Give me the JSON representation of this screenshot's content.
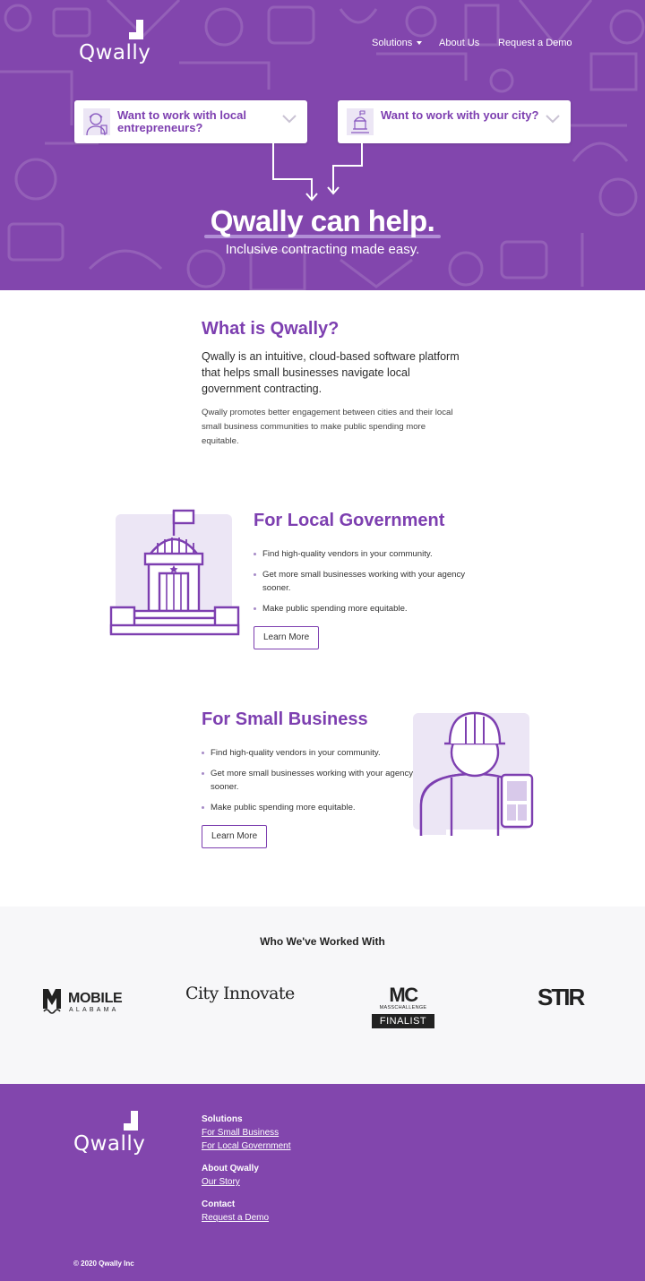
{
  "brand": {
    "name": "Qwally"
  },
  "nav": {
    "solutions": "Solutions",
    "about": "About Us",
    "demo": "Request a Demo"
  },
  "hero": {
    "card_left": "Want to work with local entrepreneurs?",
    "card_right": "Want to work with your city?",
    "title": "Qwally can help.",
    "subtitle": "Inclusive contracting made easy."
  },
  "what": {
    "title": "What is Qwally?",
    "lead": "Qwally is an intuitive, cloud-based software platform that helps small businesses navigate local government contracting.",
    "small": "Qwally promotes better engagement between cities and their local small business communities to make public spending more equitable."
  },
  "gov": {
    "title": "For Local Government",
    "bullets": [
      "Find high-quality vendors in your community.",
      "Get more small businesses working with your agency sooner.",
      "Make public spending more equitable."
    ],
    "button": "Learn More"
  },
  "biz": {
    "title": "For Small Business",
    "bullets": [
      "Find high-quality vendors in your community.",
      "Get more small businesses working with your agency sooner.",
      "Make public spending more equitable."
    ],
    "button": "Learn More"
  },
  "partners": {
    "title": "Who We've Worked With",
    "mobile_1": "MOBILE",
    "mobile_2": "ALABAMA",
    "city": "City Innovate",
    "mc": "MC",
    "mc_sub": "MASSCHALLENGE",
    "mc_badge": "FINALIST",
    "stir": "STIR"
  },
  "footer": {
    "solutions": "Solutions",
    "small_business": "For Small Business",
    "local_gov": "For Local Government",
    "about": "About Qwally",
    "story": "Our Story",
    "contact": "Contact",
    "demo": "Request a Demo",
    "copyright": "© 2020 Qwally Inc"
  },
  "colors": {
    "brand_purple": "#8246ad",
    "accent_purple": "#7d3fb0",
    "light_purple": "#ece6f5"
  }
}
